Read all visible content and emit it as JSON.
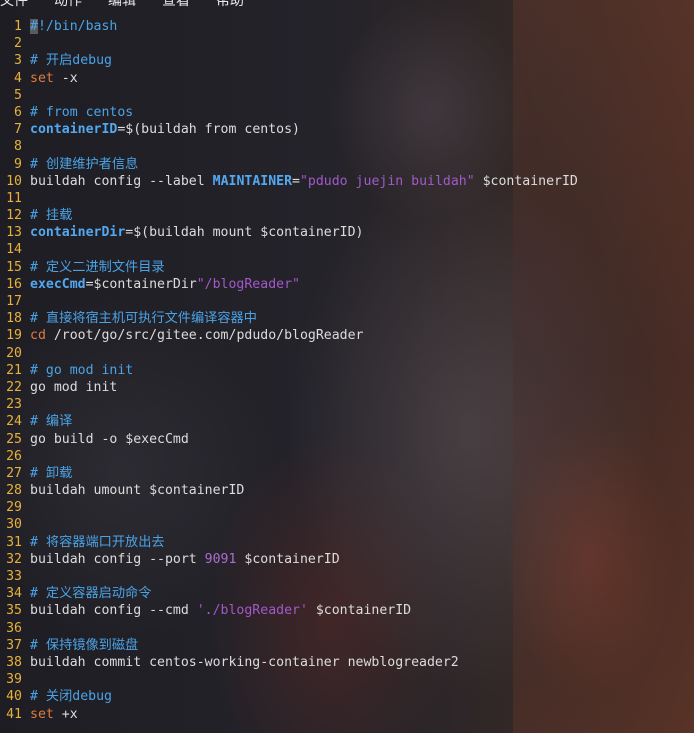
{
  "menu": [
    "文件",
    "动作",
    "编辑",
    "查看",
    "帮助"
  ],
  "lines": [
    {
      "n": "1",
      "segs": [
        {
          "t": "#",
          "c": "cursor"
        },
        {
          "t": "!/bin/bash",
          "c": "comment"
        }
      ]
    },
    {
      "n": "2",
      "segs": []
    },
    {
      "n": "3",
      "segs": [
        {
          "t": "# 开启debug",
          "c": "comment"
        }
      ]
    },
    {
      "n": "4",
      "segs": [
        {
          "t": "set",
          "c": "kw"
        },
        {
          "t": " -x",
          "c": "plain"
        }
      ]
    },
    {
      "n": "5",
      "segs": []
    },
    {
      "n": "6",
      "segs": [
        {
          "t": "# from centos",
          "c": "comment"
        }
      ]
    },
    {
      "n": "7",
      "segs": [
        {
          "t": "containerID",
          "c": "var"
        },
        {
          "t": "=$(buildah from centos)",
          "c": "plain"
        }
      ]
    },
    {
      "n": "8",
      "segs": []
    },
    {
      "n": "9",
      "segs": [
        {
          "t": "# 创建维护者信息",
          "c": "comment"
        }
      ]
    },
    {
      "n": "10",
      "segs": [
        {
          "t": "buildah config --label ",
          "c": "plain"
        },
        {
          "t": "MAINTAINER",
          "c": "var"
        },
        {
          "t": "=",
          "c": "plain"
        },
        {
          "t": "\"pdudo juejin buildah\"",
          "c": "str"
        },
        {
          "t": " $containerID",
          "c": "plain"
        }
      ]
    },
    {
      "n": "11",
      "segs": []
    },
    {
      "n": "12",
      "segs": [
        {
          "t": "# 挂载",
          "c": "comment"
        }
      ]
    },
    {
      "n": "13",
      "segs": [
        {
          "t": "containerDir",
          "c": "var"
        },
        {
          "t": "=$(buildah mount $containerID)",
          "c": "plain"
        }
      ]
    },
    {
      "n": "14",
      "segs": []
    },
    {
      "n": "15",
      "segs": [
        {
          "t": "# 定义二进制文件目录",
          "c": "comment"
        }
      ]
    },
    {
      "n": "16",
      "segs": [
        {
          "t": "execCmd",
          "c": "var"
        },
        {
          "t": "=$containerDir",
          "c": "plain"
        },
        {
          "t": "\"/blogReader\"",
          "c": "str"
        }
      ]
    },
    {
      "n": "17",
      "segs": []
    },
    {
      "n": "18",
      "segs": [
        {
          "t": "# 直接将宿主机可执行文件编译容器中",
          "c": "comment"
        }
      ]
    },
    {
      "n": "19",
      "segs": [
        {
          "t": "cd",
          "c": "kw"
        },
        {
          "t": " /root/go/src/gitee.com/pdudo/blogReader",
          "c": "plain"
        }
      ]
    },
    {
      "n": "20",
      "segs": []
    },
    {
      "n": "21",
      "segs": [
        {
          "t": "# go mod init",
          "c": "comment"
        }
      ]
    },
    {
      "n": "22",
      "segs": [
        {
          "t": "go mod init",
          "c": "plain"
        }
      ]
    },
    {
      "n": "23",
      "segs": []
    },
    {
      "n": "24",
      "segs": [
        {
          "t": "# 编译",
          "c": "comment"
        }
      ]
    },
    {
      "n": "25",
      "segs": [
        {
          "t": "go build -o $execCmd",
          "c": "plain"
        }
      ]
    },
    {
      "n": "26",
      "segs": []
    },
    {
      "n": "27",
      "segs": [
        {
          "t": "# 卸载",
          "c": "comment"
        }
      ]
    },
    {
      "n": "28",
      "segs": [
        {
          "t": "buildah umount $containerID",
          "c": "plain"
        }
      ]
    },
    {
      "n": "29",
      "segs": []
    },
    {
      "n": "30",
      "segs": []
    },
    {
      "n": "31",
      "segs": [
        {
          "t": "# 将容器端口开放出去",
          "c": "comment"
        }
      ]
    },
    {
      "n": "32",
      "segs": [
        {
          "t": "buildah config --port ",
          "c": "plain"
        },
        {
          "t": "9091",
          "c": "num"
        },
        {
          "t": " $containerID",
          "c": "plain"
        }
      ]
    },
    {
      "n": "33",
      "segs": []
    },
    {
      "n": "34",
      "segs": [
        {
          "t": "# 定义容器启动命令",
          "c": "comment"
        }
      ]
    },
    {
      "n": "35",
      "segs": [
        {
          "t": "buildah config --cmd ",
          "c": "plain"
        },
        {
          "t": "'./blogReader'",
          "c": "str"
        },
        {
          "t": " $containerID",
          "c": "plain"
        }
      ]
    },
    {
      "n": "36",
      "segs": []
    },
    {
      "n": "37",
      "segs": [
        {
          "t": "# 保持镜像到磁盘",
          "c": "comment"
        }
      ]
    },
    {
      "n": "38",
      "segs": [
        {
          "t": "buildah commit centos-working-container newblogreader2",
          "c": "plain"
        }
      ]
    },
    {
      "n": "39",
      "segs": []
    },
    {
      "n": "40",
      "segs": [
        {
          "t": "# 关闭debug",
          "c": "comment"
        }
      ]
    },
    {
      "n": "41",
      "segs": [
        {
          "t": "set",
          "c": "kw"
        },
        {
          "t": " +x",
          "c": "plain"
        }
      ]
    }
  ]
}
